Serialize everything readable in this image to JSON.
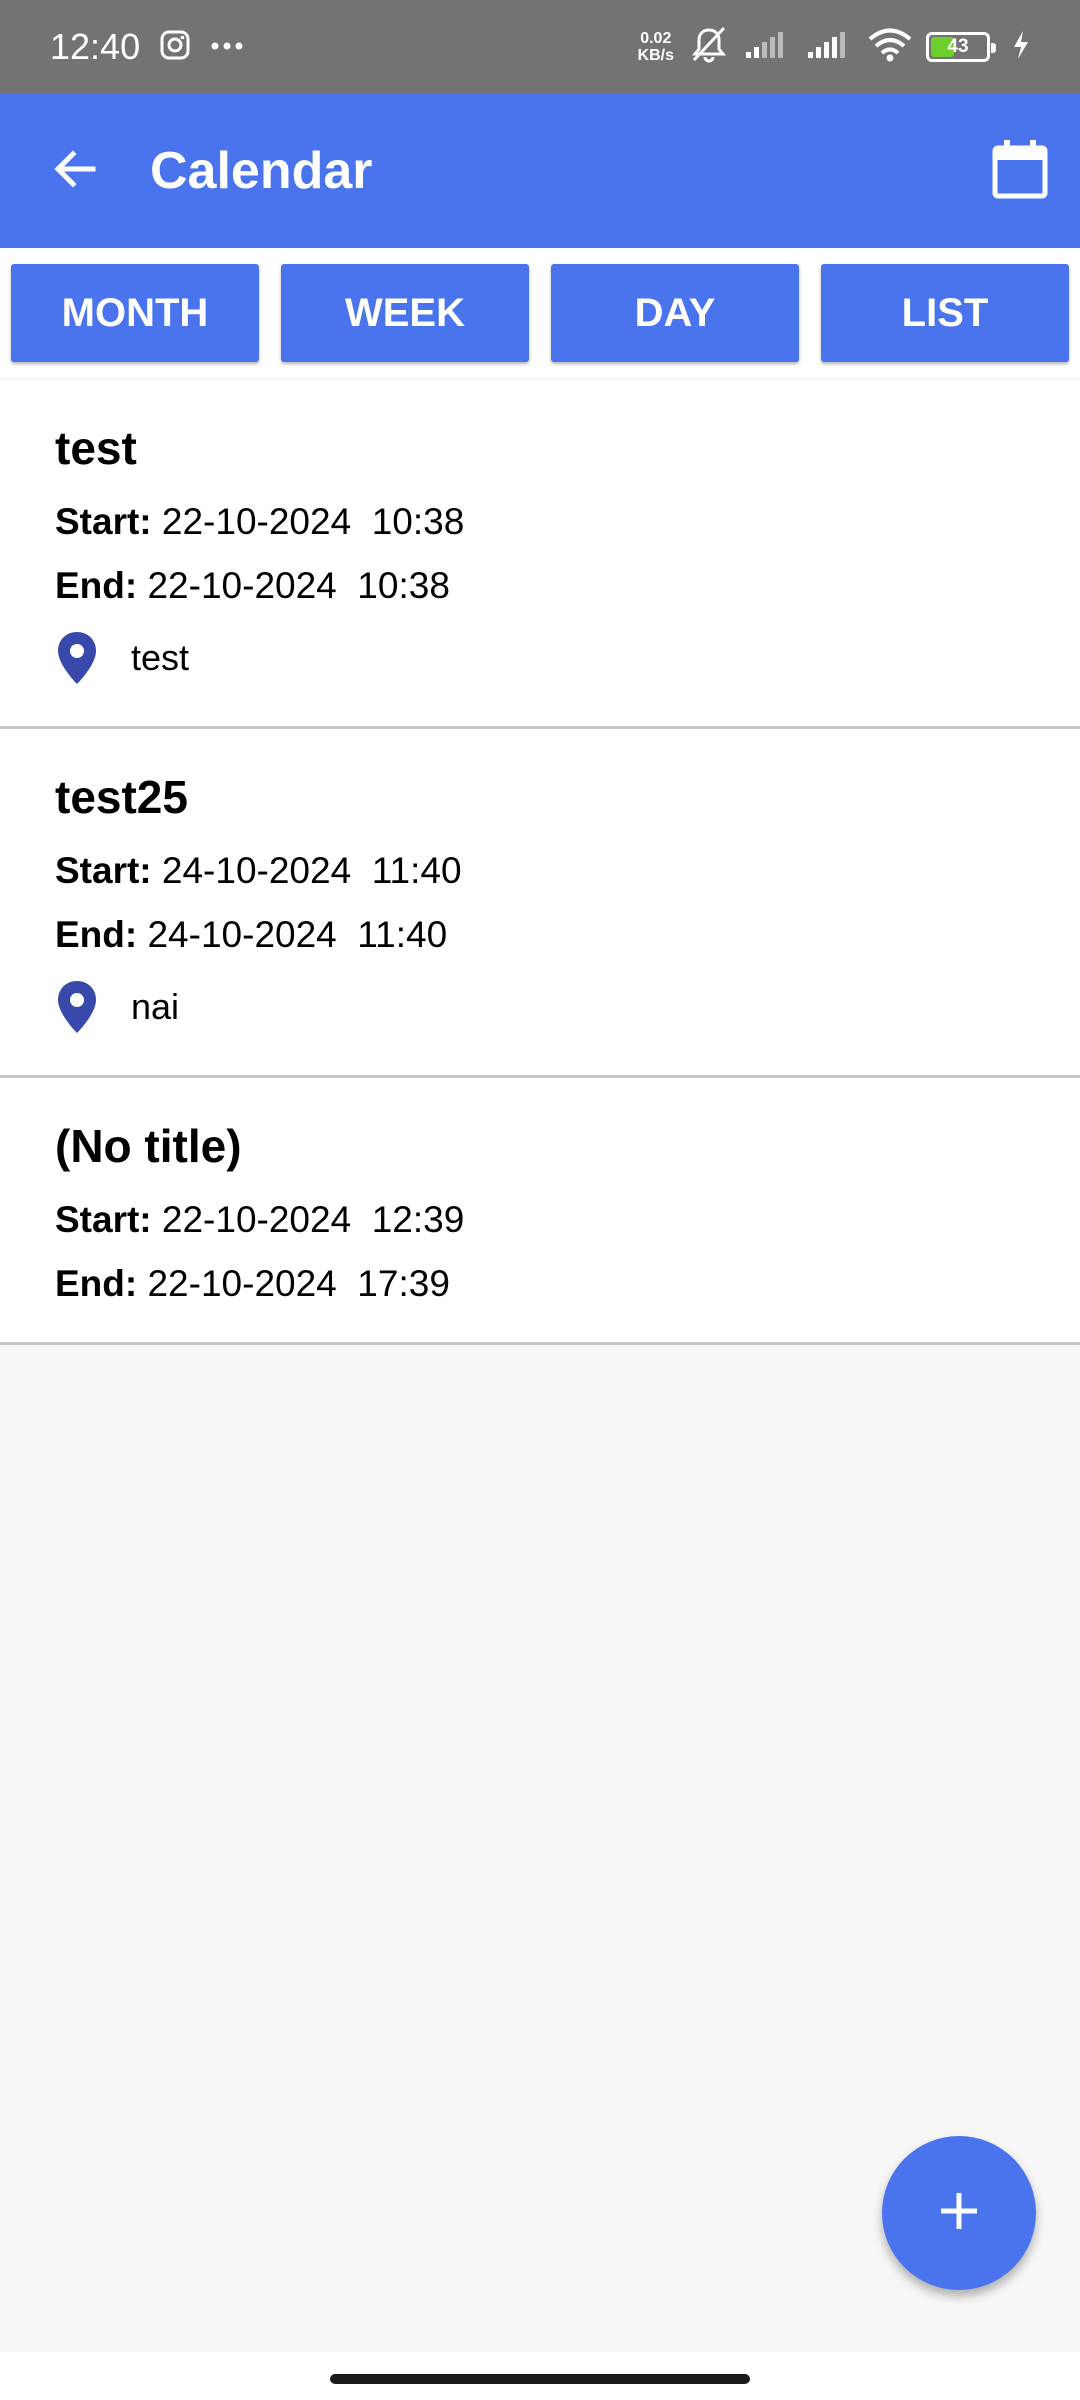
{
  "status_bar": {
    "time": "12:40",
    "net_speed_value": "0.02",
    "net_speed_unit": "KB/s",
    "battery_level": "43",
    "icons": [
      "instagram-icon",
      "more-dots-icon",
      "mute-icon",
      "signal-icon",
      "wifi-icon",
      "battery-icon",
      "charging-icon"
    ]
  },
  "app_bar": {
    "title": "Calendar",
    "back_icon": "arrow-back-icon",
    "calendar_icon": "calendar-icon",
    "color": "#4a74ed"
  },
  "tabs": [
    {
      "label": "MONTH"
    },
    {
      "label": "WEEK"
    },
    {
      "label": "DAY"
    },
    {
      "label": "LIST"
    }
  ],
  "labels": {
    "start": "Start:",
    "end": "End:"
  },
  "events": [
    {
      "title": "test",
      "start": "22-10-2024  10:38",
      "end": "22-10-2024  10:38",
      "location": "test"
    },
    {
      "title": "test25",
      "start": "24-10-2024  11:40",
      "end": "24-10-2024  11:40",
      "location": "nai"
    },
    {
      "title": "(No title)",
      "start": "22-10-2024  12:39",
      "end": "22-10-2024  17:39"
    }
  ],
  "fab": {
    "icon": "plus-icon"
  }
}
